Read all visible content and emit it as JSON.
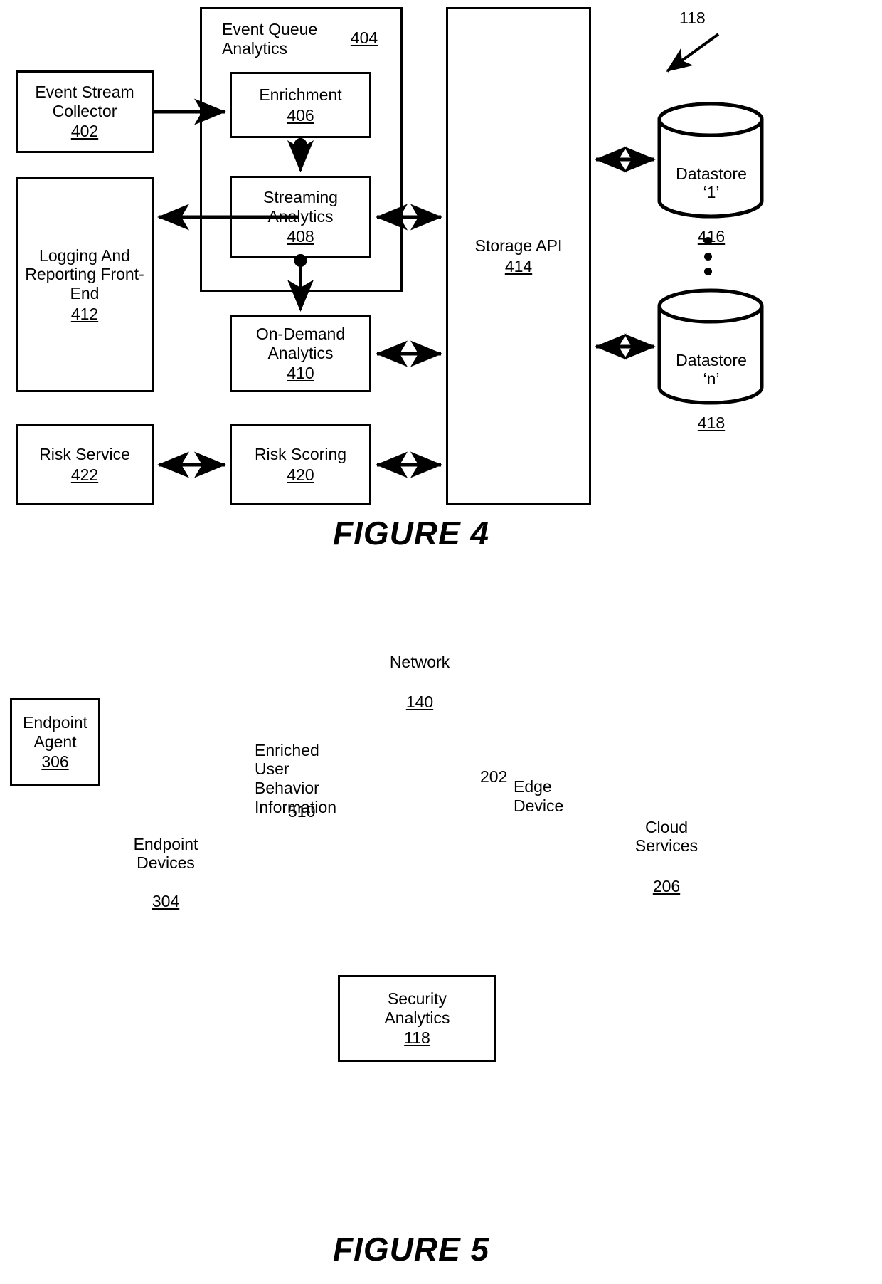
{
  "figure4": {
    "caption": "FIGURE 4",
    "container": {
      "label": "Event Queue\nAnalytics",
      "ref": "404"
    },
    "pointer_ref": "118",
    "boxes": [
      {
        "id": "event-stream-collector",
        "label": "Event Stream\nCollector",
        "ref": "402"
      },
      {
        "id": "enrichment",
        "label": "Enrichment",
        "ref": "406"
      },
      {
        "id": "streaming-analytics",
        "label": "Streaming\nAnalytics",
        "ref": "408"
      },
      {
        "id": "logging-and-reporting-front-end",
        "label": "Logging\nAnd Reporting\nFront-End",
        "ref": "412"
      },
      {
        "id": "on-demand-analytics",
        "label": "On-Demand\nAnalytics",
        "ref": "410"
      },
      {
        "id": "storage-api",
        "label": "Storage\nAPI",
        "ref": "414"
      },
      {
        "id": "risk-service",
        "label": "Risk\nService",
        "ref": "422"
      },
      {
        "id": "risk-scoring",
        "label": "Risk\nScoring",
        "ref": "420"
      }
    ],
    "datastores": [
      {
        "id": "datastore-1",
        "label": "Datastore\n‘1’",
        "ref": "416"
      },
      {
        "id": "datastore-n",
        "label": "Datastore\n‘n’",
        "ref": "418"
      }
    ]
  },
  "figure5": {
    "caption": "FIGURE 5",
    "network_cloud": {
      "label": "Network",
      "ref": "140"
    },
    "cloud_services": {
      "label": "Cloud\nServices",
      "ref": "206"
    },
    "endpoint_agent": {
      "label": "Endpoint\nAgent",
      "ref": "306"
    },
    "endpoint_devices": {
      "label": "Endpoint\nDevices",
      "ref": "304"
    },
    "enriched_info": {
      "label": "Enriched\nUser\nBehavior\nInformation",
      "ref": "510"
    },
    "edge_device": {
      "label": "Edge\nDevice",
      "ref": "202"
    },
    "security_analytics": {
      "label": "Security\nAnalytics",
      "ref": "118"
    }
  }
}
